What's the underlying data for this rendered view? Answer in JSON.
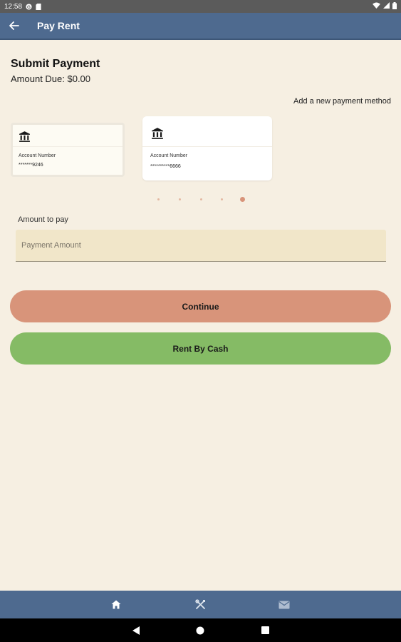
{
  "status_bar": {
    "time": "12:58",
    "icons": [
      "g-icon",
      "sd-card-icon",
      "wifi-icon",
      "signal-icon",
      "battery-icon"
    ]
  },
  "app_bar": {
    "title": "Pay Rent",
    "back_icon": "arrow-left-icon"
  },
  "payment": {
    "heading": "Submit Payment",
    "amount_due": "Amount Due: $0.00",
    "add_method_link": "Add a new payment method"
  },
  "cards": [
    {
      "icon": "bank-icon",
      "account_label": "Account Number",
      "account_number": "*******9246"
    },
    {
      "icon": "bank-icon",
      "account_label": "Account Number",
      "account_number": "**********6666"
    }
  ],
  "carousel": {
    "count": 5,
    "active_index": 4
  },
  "amount_field": {
    "label": "Amount to pay",
    "placeholder": "Payment Amount",
    "value": ""
  },
  "buttons": {
    "continue_label": "Continue",
    "cash_label": "Rent By Cash"
  },
  "bottom_nav": {
    "items": [
      "home-icon",
      "tools-icon",
      "mail-icon"
    ]
  },
  "system_nav": {
    "items": [
      "back-triangle-icon",
      "home-circle-icon",
      "recents-square-icon"
    ]
  },
  "colors": {
    "background": "#f6efe2",
    "app_bar": "#4e6a8f",
    "continue": "#d8947a",
    "cash": "#85bb65",
    "input_fill": "#f1e6c9"
  }
}
